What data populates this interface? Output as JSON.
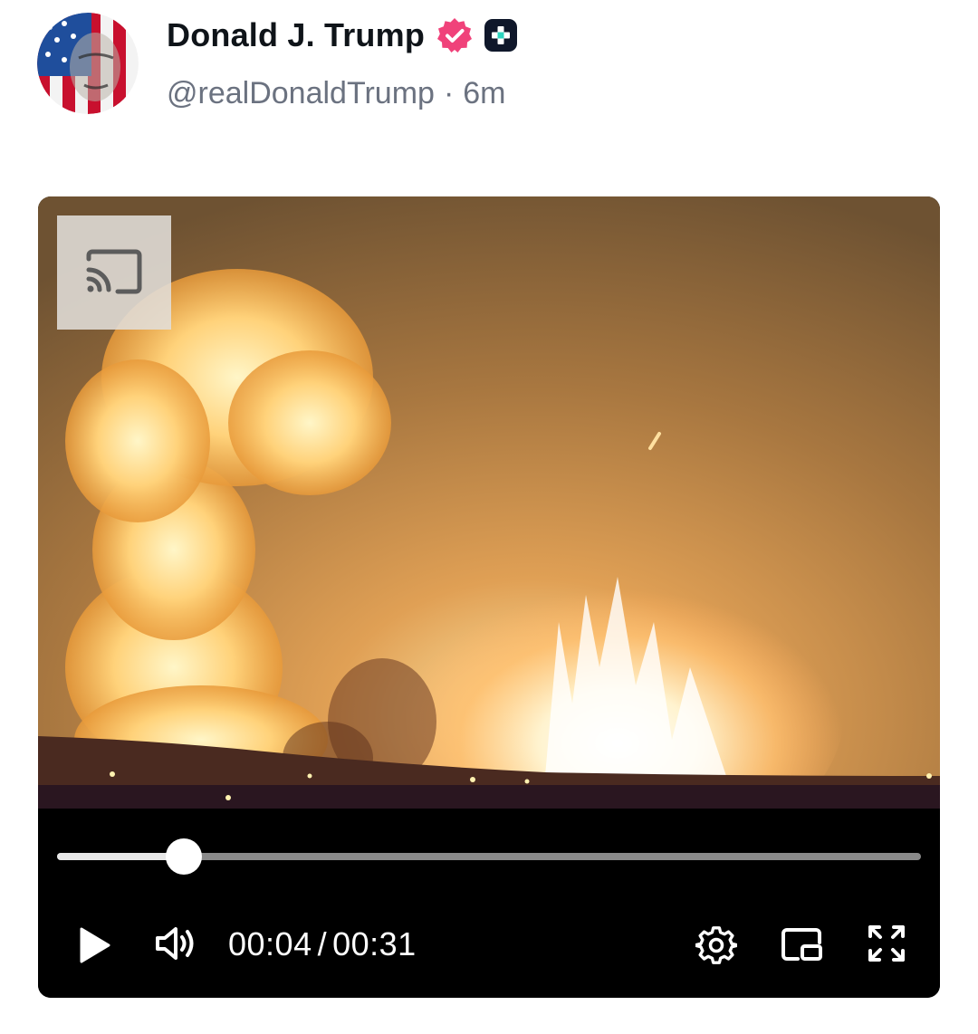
{
  "author": {
    "display_name": "Donald J. Trump",
    "handle": "@realDonaldTrump",
    "separator": "·",
    "time_ago": "6m",
    "verified_badge_color": "#f0427a",
    "plus_badge_color": "#0f172a",
    "plus_badge_accent": "#2dd4bf"
  },
  "video": {
    "cast_icon": "cast-icon",
    "current_time": "00:04",
    "time_separator": "/",
    "duration": "00:31",
    "progress_fraction": 0.147,
    "controls": {
      "play_icon": "play-icon",
      "volume_icon": "volume-icon",
      "settings_icon": "gear-icon",
      "pip_icon": "picture-in-picture-icon",
      "fullscreen_icon": "fullscreen-icon"
    }
  }
}
